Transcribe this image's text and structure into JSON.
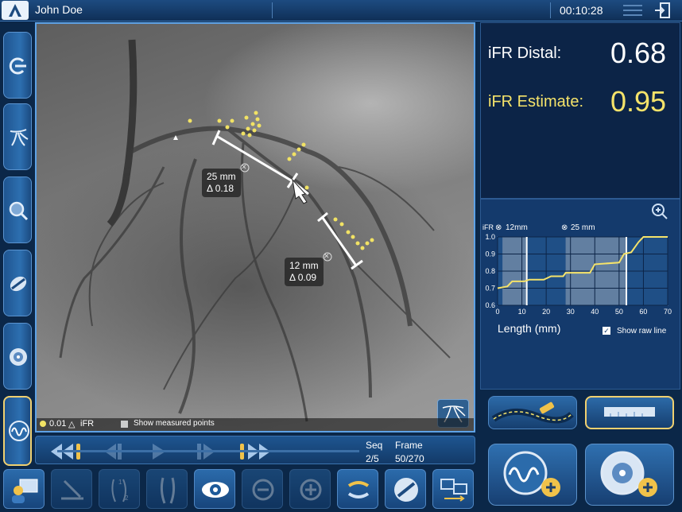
{
  "header": {
    "patient_name": "John Doe",
    "time": "00:10:28",
    "icons": [
      "menu-icon",
      "exit-icon"
    ]
  },
  "left_toolbar": {
    "buttons": [
      "co-registration-icon",
      "vessel-tree-icon",
      "zoom-lens-icon",
      "pullback-icon",
      "ivus-icon",
      "ifr-wave-icon"
    ]
  },
  "angio": {
    "measurements": [
      {
        "length": "25 mm",
        "delta": "Δ 0.18"
      },
      {
        "length": "12 mm",
        "delta": "Δ 0.09"
      }
    ],
    "legend_value": "0.01",
    "legend_label": "iFR",
    "show_measured_points": "Show measured points"
  },
  "playback": {
    "seq_label": "Seq",
    "frame_label": "Frame",
    "seq_value": "2/5",
    "frame_value": "50/270"
  },
  "bottom_toolbar": {
    "buttons": [
      "user-workstation-icon",
      "ruler-icon",
      "segments-icon",
      "vessel-icon",
      "eye-icon",
      "zoom-out-icon",
      "zoom-in-icon",
      "swap-icon",
      "pullback-icon",
      "display-switch-icon"
    ]
  },
  "results": {
    "distal_label": "iFR Distal:",
    "distal_value": "0.68",
    "estimate_label": "iFR Estimate:",
    "estimate_value": "0.95",
    "estimate_color": "#f5e36a"
  },
  "chart": {
    "ifr_label": "iFR",
    "seg1_label": "12mm",
    "seg2_label": "25 mm",
    "xlabel": "Length (mm)",
    "show_raw_line": "Show raw line",
    "yticks": [
      "1.0",
      "0.9",
      "0.8",
      "0.7",
      "0.6"
    ],
    "xticks": [
      "0",
      "10",
      "20",
      "30",
      "40",
      "50",
      "60",
      "70"
    ]
  },
  "chart_data": {
    "type": "line",
    "xlabel": "Length (mm)",
    "ylabel": "iFR",
    "xlim": [
      0,
      70
    ],
    "ylim": [
      0.6,
      1.0
    ],
    "series": [
      {
        "x": [
          0,
          4,
          6,
          11,
          13,
          19,
          22,
          27,
          28,
          38,
          40,
          50,
          52,
          55,
          58,
          60,
          70
        ],
        "y": [
          0.7,
          0.71,
          0.74,
          0.74,
          0.75,
          0.75,
          0.77,
          0.77,
          0.79,
          0.79,
          0.84,
          0.85,
          0.9,
          0.91,
          0.97,
          1.0,
          1.0
        ]
      }
    ],
    "highlighted_ranges": [
      [
        2,
        12
      ],
      [
        28,
        53
      ]
    ],
    "line_color": "#f5e36a"
  }
}
